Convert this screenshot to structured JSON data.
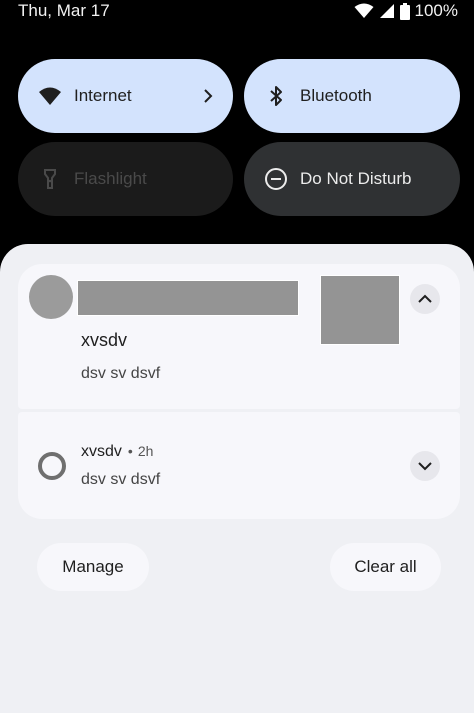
{
  "status_bar": {
    "date": "Thu, Mar 17",
    "battery": "100%",
    "icons": [
      "wifi-icon",
      "signal-icon",
      "battery-icon"
    ]
  },
  "quick_settings": {
    "tiles": [
      {
        "label": "Internet",
        "icon": "wifi-icon",
        "state": "on",
        "has_chevron": true
      },
      {
        "label": "Bluetooth",
        "icon": "bluetooth-icon",
        "state": "on"
      },
      {
        "label": "Flashlight",
        "icon": "flashlight-icon",
        "state": "unavailable"
      },
      {
        "label": "Do Not Disturb",
        "icon": "do-not-disturb-icon",
        "state": "off"
      }
    ]
  },
  "notifications": [
    {
      "title": "xvsdv",
      "text": "dsv sv dsvf",
      "expanded": true,
      "icon": "avatar",
      "expand_icon": "chevron-up-icon"
    },
    {
      "title": "xvsdv",
      "separator": "•",
      "time": "2h",
      "text": "dsv sv dsvf",
      "expanded": false,
      "icon": "ring-icon",
      "expand_icon": "chevron-down-icon"
    }
  ],
  "actions": {
    "manage": "Manage",
    "clear_all": "Clear all"
  },
  "colors": {
    "tile_active": "#d3e3fd",
    "tile_inactive": "#2f3133",
    "tile_unavailable": "#1b1b1b",
    "shade_bg": "#eff0f4",
    "card_bg": "#f7f7fb"
  }
}
